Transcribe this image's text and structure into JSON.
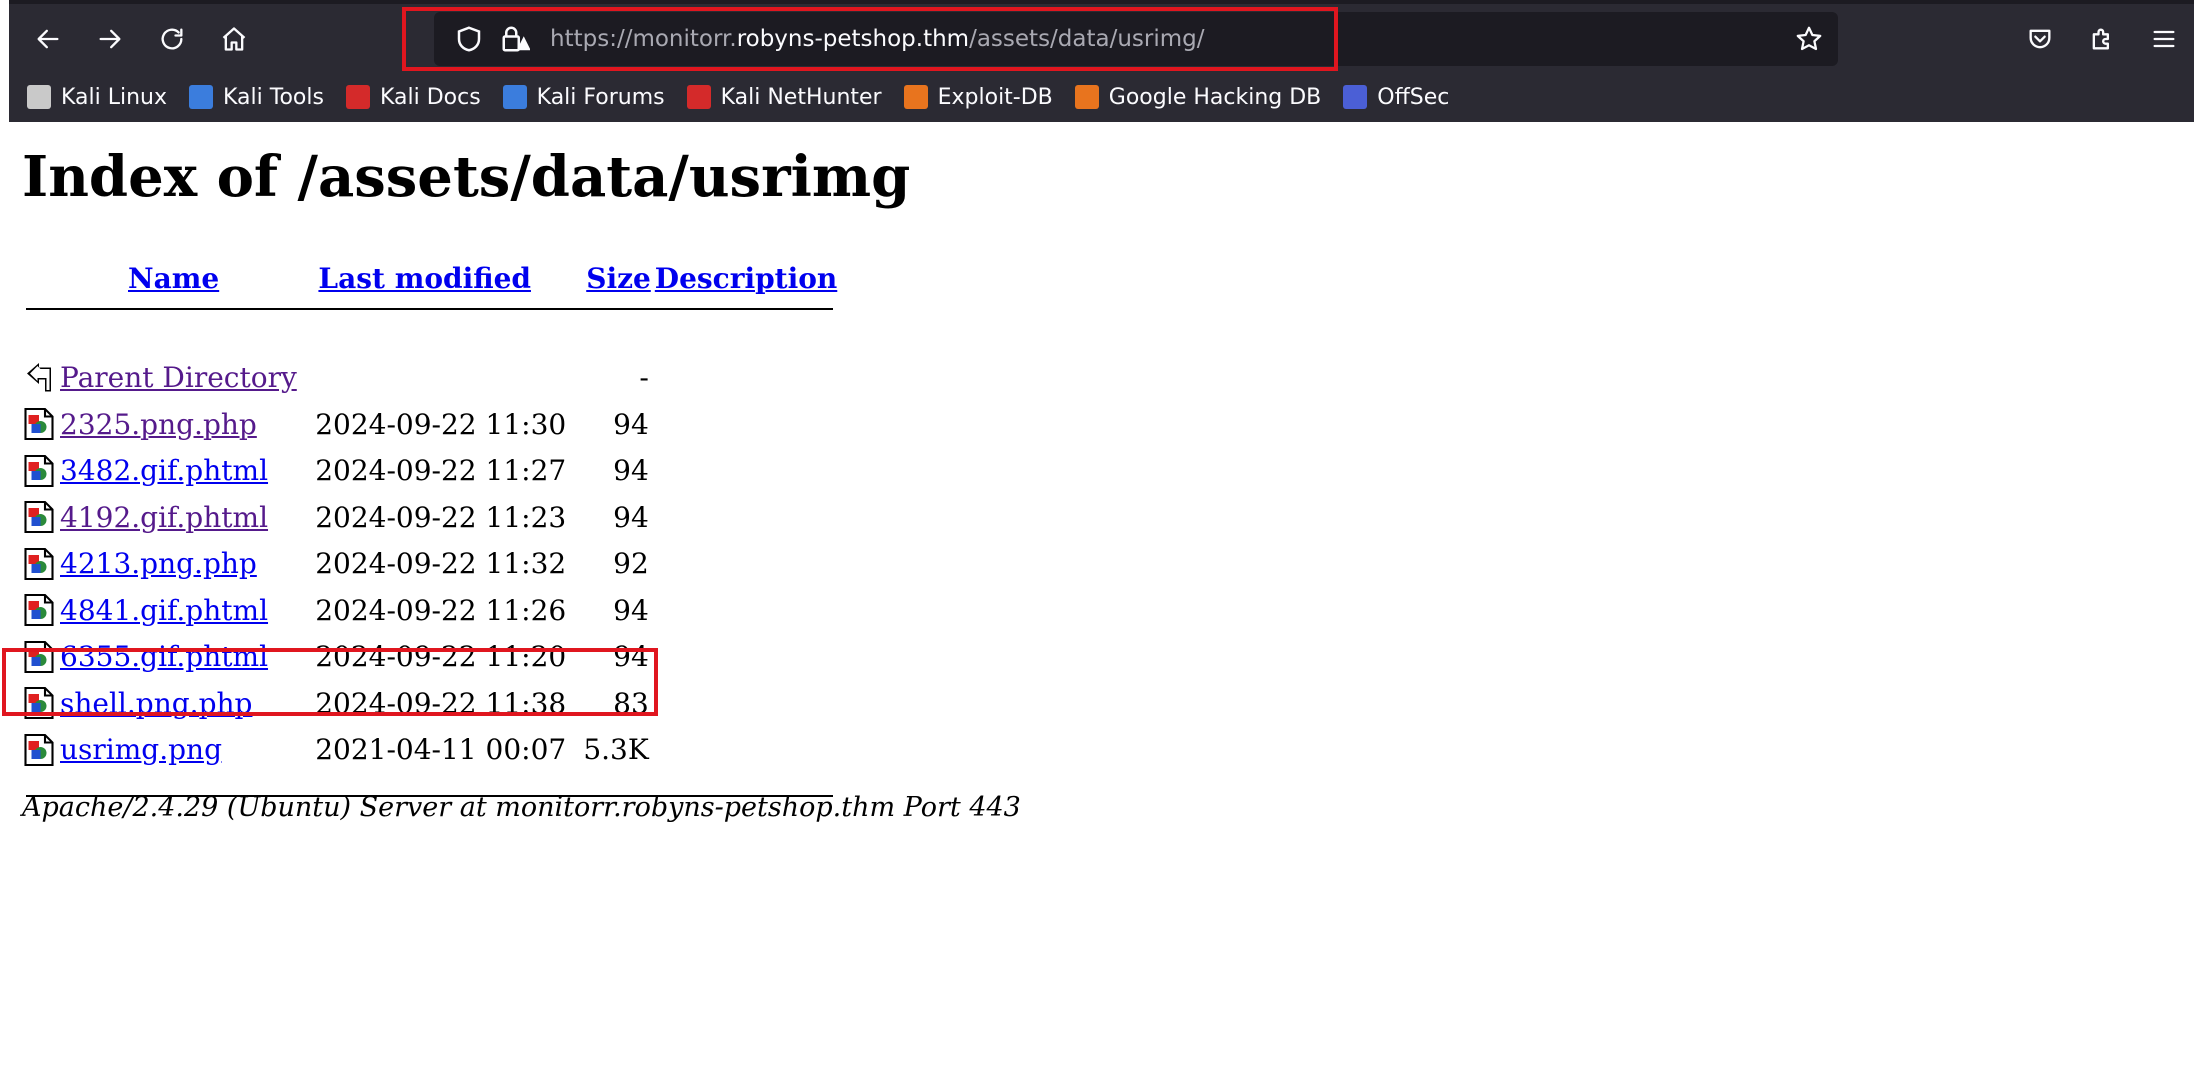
{
  "browser": {
    "url_prefix": "https://monitorr.",
    "url_host": "robyns-petshop.thm",
    "url_path": "/assets/data/usrimg/",
    "bookmarks": [
      {
        "label": "Kali Linux",
        "icon": "kali-dragon-icon",
        "color": "#c9c9c9"
      },
      {
        "label": "Kali Tools",
        "icon": "kali-tools-icon",
        "color": "#3b7ddd"
      },
      {
        "label": "Kali Docs",
        "icon": "kali-docs-icon",
        "color": "#d42a2a"
      },
      {
        "label": "Kali Forums",
        "icon": "kali-forums-icon",
        "color": "#3b7ddd"
      },
      {
        "label": "Kali NetHunter",
        "icon": "kali-nethunter-icon",
        "color": "#d42a2a"
      },
      {
        "label": "Exploit-DB",
        "icon": "exploit-db-icon",
        "color": "#e8741e"
      },
      {
        "label": "Google Hacking DB",
        "icon": "ghdb-icon",
        "color": "#e8741e"
      },
      {
        "label": "OffSec",
        "icon": "offsec-icon",
        "color": "#4b5fd6"
      }
    ]
  },
  "page": {
    "title": "Index of /assets/data/usrimg",
    "columns": {
      "name": "Name",
      "modified": "Last modified",
      "size": "Size",
      "description": "Description"
    },
    "parent": {
      "name": "Parent Directory",
      "size": "-"
    },
    "files": [
      {
        "name": "2325.png.php",
        "modified": "2024-09-22 11:30",
        "size": "94",
        "visited": true
      },
      {
        "name": "3482.gif.phtml",
        "modified": "2024-09-22 11:27",
        "size": "94",
        "visited": false
      },
      {
        "name": "4192.gif.phtml",
        "modified": "2024-09-22 11:23",
        "size": "94",
        "visited": true
      },
      {
        "name": "4213.png.php",
        "modified": "2024-09-22 11:32",
        "size": "92",
        "visited": false
      },
      {
        "name": "4841.gif.phtml",
        "modified": "2024-09-22 11:26",
        "size": "94",
        "visited": false
      },
      {
        "name": "6355.gif.phtml",
        "modified": "2024-09-22 11:20",
        "size": "94",
        "visited": false
      },
      {
        "name": "shell.png.php",
        "modified": "2024-09-22 11:38",
        "size": "83",
        "visited": false
      },
      {
        "name": "usrimg.png",
        "modified": "2021-04-11 00:07",
        "size": "5.3K",
        "visited": false
      }
    ],
    "footer": "Apache/2.4.29 (Ubuntu) Server at monitorr.robyns-petshop.thm Port 443"
  },
  "colors": {
    "highlight": "#e0161f",
    "link": "#0000ee",
    "visited": "#551a8b",
    "chrome": "#2b2a33"
  }
}
